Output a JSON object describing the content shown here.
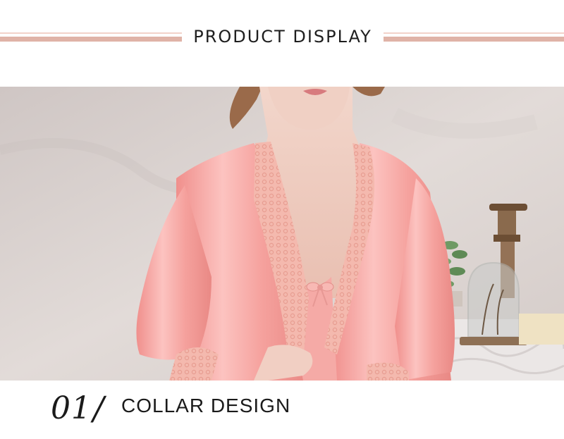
{
  "header": {
    "title": "PRODUCT DISPLAY",
    "rule_thin_color": "#f2d2c9",
    "rule_thick_color": "#e0b3a7"
  },
  "photo": {
    "subject": "model-in-pink-satin-robe",
    "colors": {
      "wall": "#dcd3d0",
      "satin": "#f6a8a6",
      "lace": "#f3b3a8",
      "skin": "#f0cfc2"
    }
  },
  "section": {
    "number": "01",
    "separator": "/",
    "label": "COLLAR DESIGN"
  }
}
